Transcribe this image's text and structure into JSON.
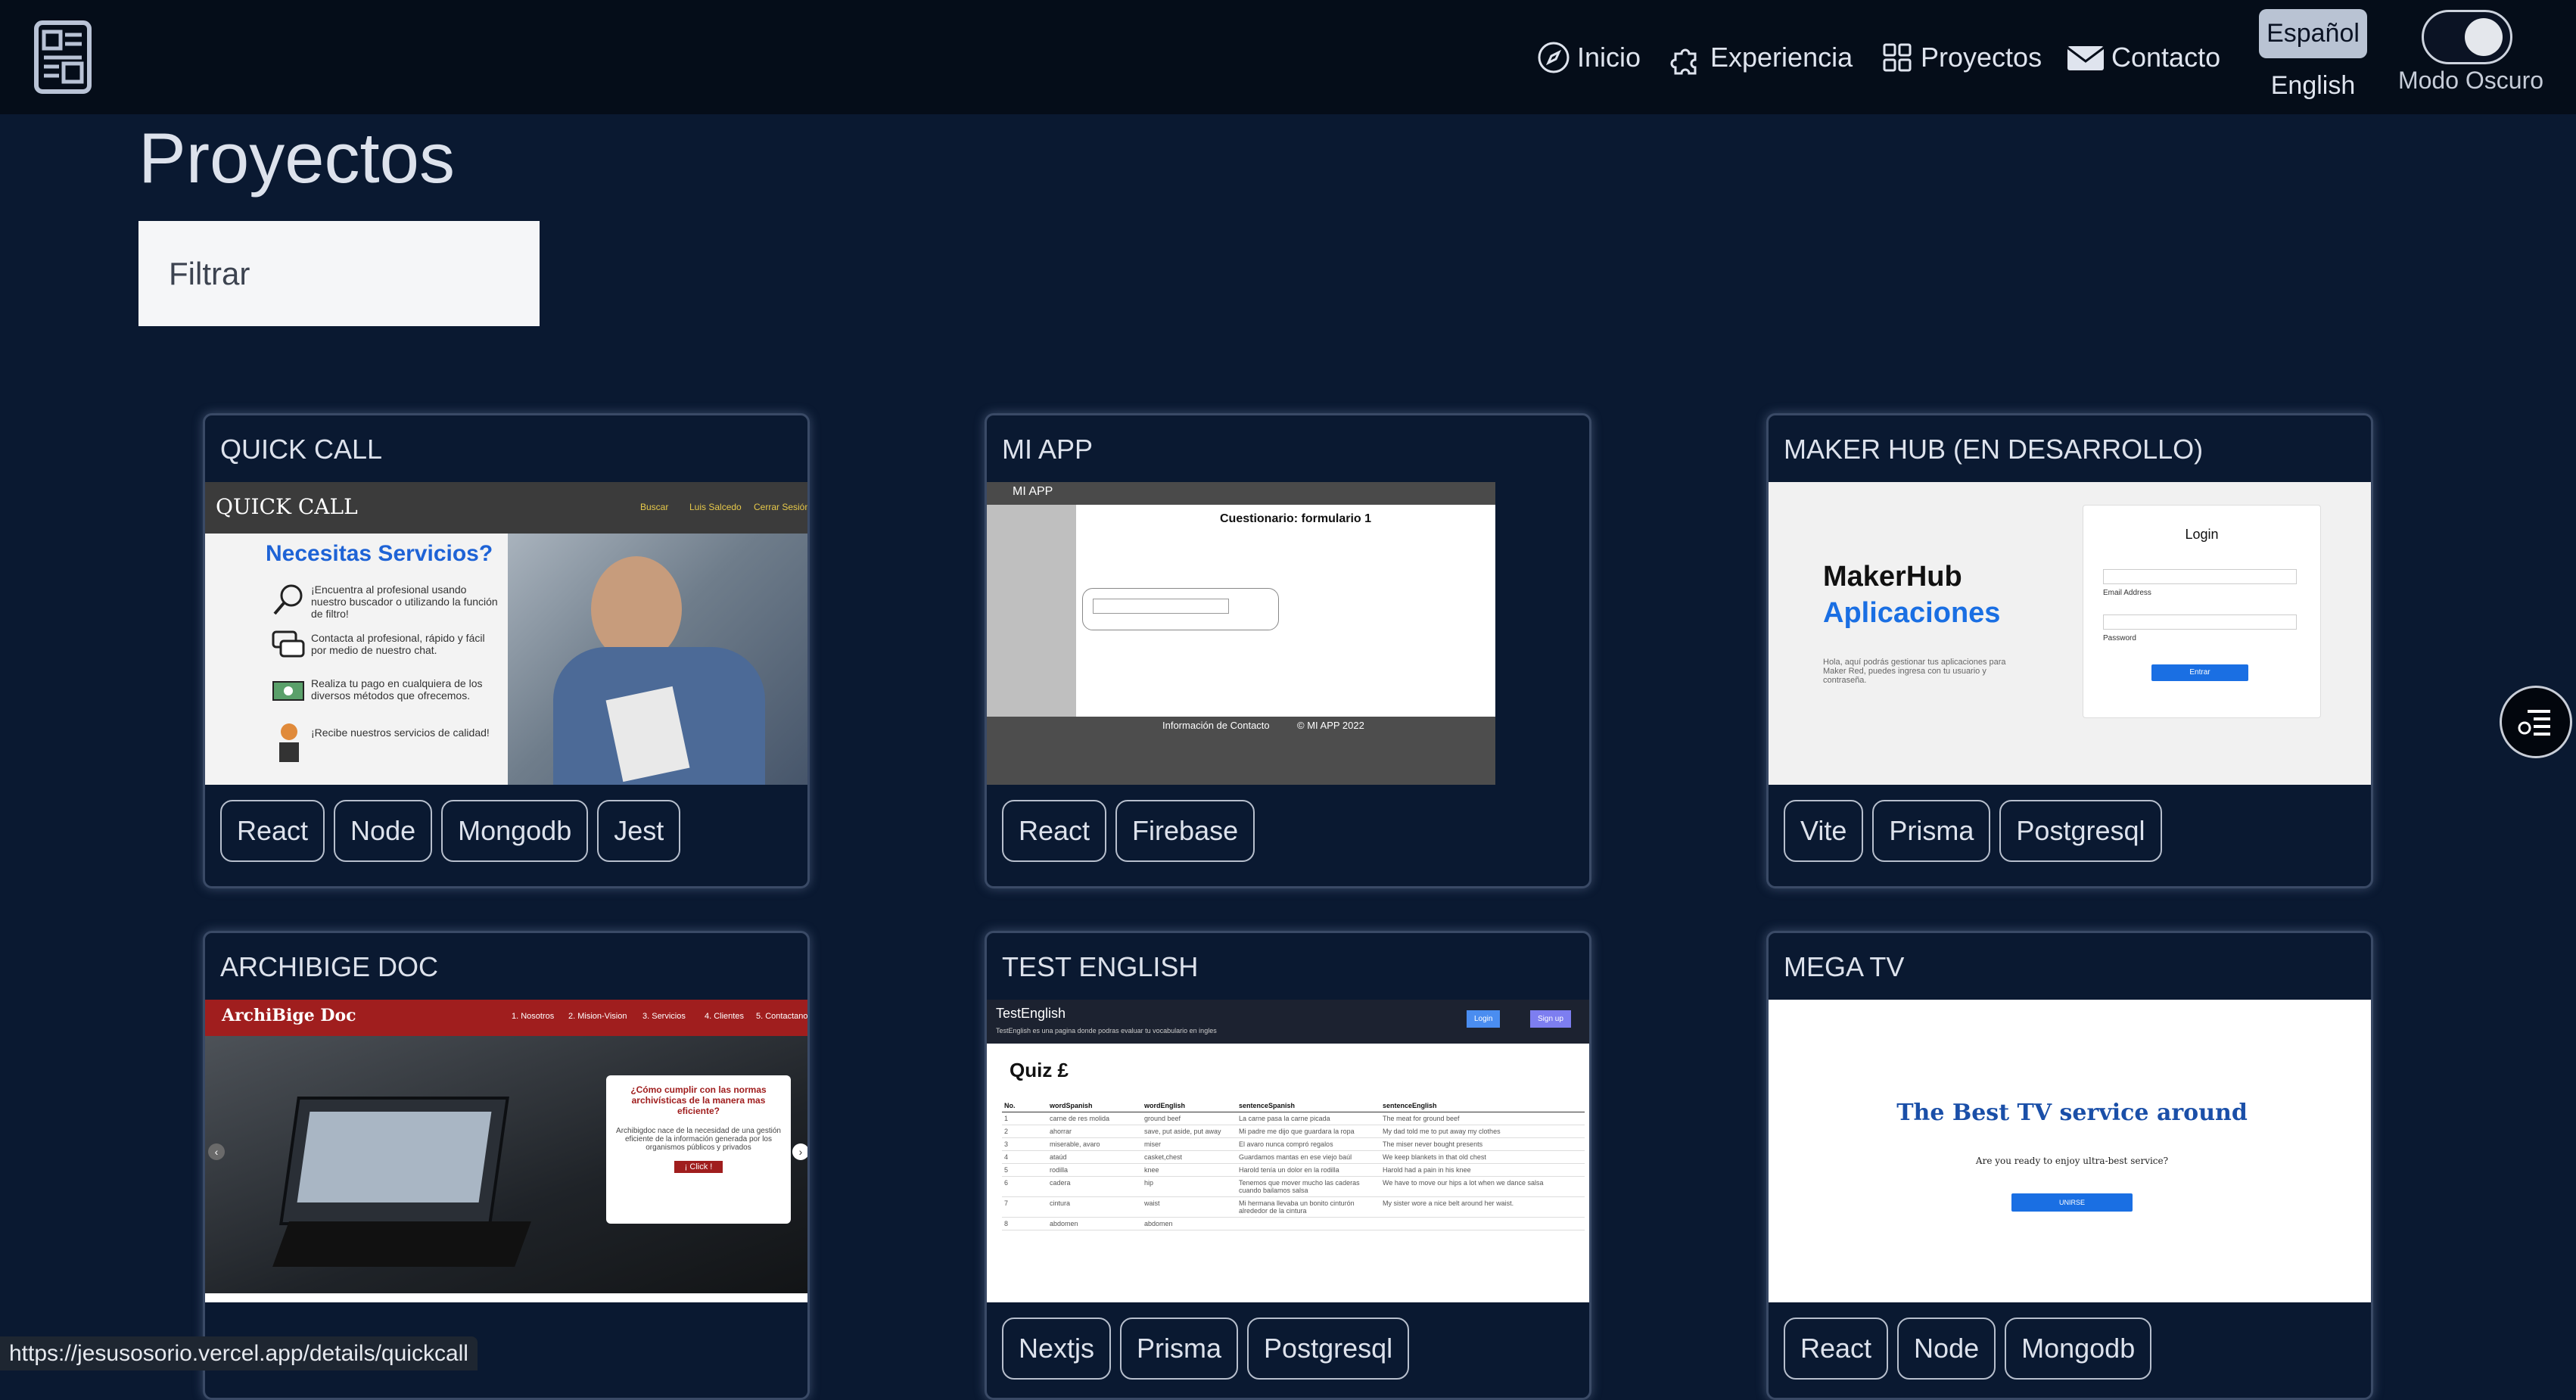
{
  "nav": {
    "items": [
      {
        "label": "Inicio",
        "icon": "compass-icon"
      },
      {
        "label": "Experiencia",
        "icon": "puzzle-icon"
      },
      {
        "label": "Proyectos",
        "icon": "grid-icon"
      },
      {
        "label": "Contacto",
        "icon": "envelope-icon"
      }
    ],
    "lang_es": "Español",
    "lang_en": "English",
    "dark_mode_label": "Modo Oscuro"
  },
  "page": {
    "title": "Proyectos",
    "filter_placeholder": "Filtrar"
  },
  "projects": [
    {
      "title": "QUICK CALL",
      "tags": [
        "React",
        "Node",
        "Mongodb",
        "Jest"
      ]
    },
    {
      "title": "MI APP",
      "tags": [
        "React",
        "Firebase"
      ]
    },
    {
      "title": "MAKER HUB (EN DESARROLLO)",
      "tags": [
        "Vite",
        "Prisma",
        "Postgresql"
      ]
    },
    {
      "title": "ARCHIBIGE DOC",
      "tags": []
    },
    {
      "title": "TEST ENGLISH",
      "tags": [
        "Nextjs",
        "Prisma",
        "Postgresql"
      ]
    },
    {
      "title": "MEGA TV",
      "tags": [
        "React",
        "Node",
        "Mongodb"
      ]
    }
  ],
  "previews": {
    "quickcall": {
      "brand": "QUICK CALL",
      "nav": [
        "Buscar",
        "Luis Salcedo",
        "Cerrar Sesión"
      ],
      "headline": "Necesitas Servicios?",
      "bullets": [
        "¡Encuentra al profesional usando nuestro buscador o utilizando la función de filtro!",
        "Contacta al profesional, rápido y fácil por medio de nuestro chat.",
        "Realiza tu pago en cualquiera de los diversos métodos que ofrecemos.",
        "¡Recibe nuestros servicios de calidad!"
      ]
    },
    "miapp": {
      "brand": "MI APP",
      "form_title": "Cuestionario: formulario 1",
      "footer": "Información de Contacto",
      "copyright": "© MI APP 2022"
    },
    "makerhub": {
      "brand_line1": "MakerHub",
      "brand_line2": "Aplicaciones",
      "desc": "Hola, aquí podrás gestionar tus aplicaciones para Maker Red, puedes ingresa con tu usuario y contraseña.",
      "login_title": "Login",
      "email_label": "Email Address",
      "password_label": "Password",
      "button": "Entrar"
    },
    "archibige": {
      "brand": "ArchiBige Doc",
      "nav": [
        "1. Nosotros",
        "2. Mision-Vision",
        "3. Servicios",
        "4. Clientes",
        "5. Contactanos"
      ],
      "question": "¿Cómo cumplir con las normas archivísticas de la manera mas eficiente?",
      "text": "Archibigdoc nace de la necesidad de una gestión eficiente de la información generada por los organismos públicos y privados",
      "cta": "¡ Click !"
    },
    "testenglish": {
      "brand": "TestEnglish",
      "subtitle": "TestEnglish es una pagina donde podras evaluar tu vocabulario en ingles",
      "login": "Login",
      "signup": "Sign up",
      "quiz": "Quiz £",
      "columns": [
        "No.",
        "wordSpanish",
        "wordEnglish",
        "sentenceSpanish",
        "sentenceEnglish"
      ],
      "rows": [
        [
          "1",
          "carne de res molida",
          "ground beef",
          "La carne pasa la carne picada",
          "The meat for ground beef"
        ],
        [
          "2",
          "ahorrar",
          "save, put aside, put away",
          "Mi padre me dijo que guardara la ropa",
          "My dad told me to put away my clothes"
        ],
        [
          "3",
          "miserable, avaro",
          "miser",
          "El avaro nunca compró regalos",
          "The miser never bought presents"
        ],
        [
          "4",
          "ataúd",
          "casket,chest",
          "Guardamos mantas en ese viejo baúl",
          "We keep blankets in that old chest"
        ],
        [
          "5",
          "rodilla",
          "knee",
          "Harold tenía un dolor en la rodilla",
          "Harold had a pain in his knee"
        ],
        [
          "6",
          "cadera",
          "hip",
          "Tenemos que mover mucho las caderas cuando bailamos salsa",
          "We have to move our hips a lot when we dance salsa"
        ],
        [
          "7",
          "cintura",
          "waist",
          "Mi hermana llevaba un bonito cinturón alrededor de la cintura",
          "My sister wore a nice belt around her waist."
        ],
        [
          "8",
          "abdomen",
          "abdomen",
          "",
          ""
        ]
      ]
    },
    "megatv": {
      "headline": "The Best TV service around",
      "sub": "Are you ready to enjoy ultra-best service?",
      "button": "UNIRSE"
    }
  },
  "status_url": "https://jesusosorio.vercel.app/details/quickcall",
  "colors": {
    "background": "#0a1931",
    "topbar": "#050d19",
    "card_border": "#3a4a66",
    "accent_blue": "#1a6fe3"
  }
}
